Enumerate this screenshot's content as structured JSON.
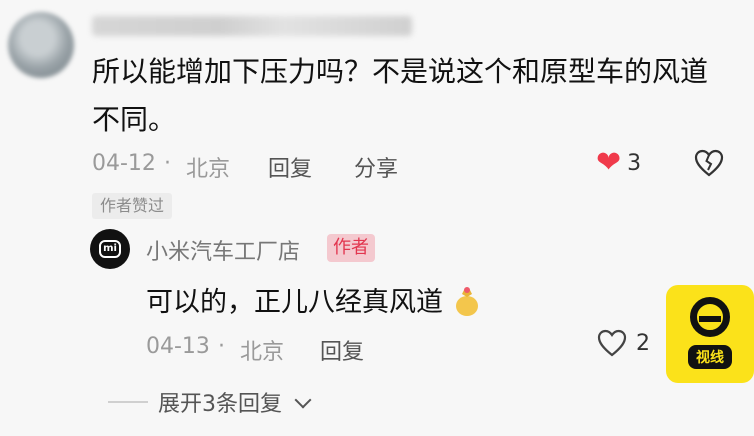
{
  "comment": {
    "text_line1": "所以能增加下压力吗？不是说这个和原型车的风道",
    "text_line2": "不同。",
    "date": "04-12",
    "separator": "·",
    "location": "北京",
    "reply_label": "回复",
    "share_label": "分享",
    "like_count": "3",
    "author_liked_label": "作者赞过"
  },
  "reply": {
    "author_name": "小米汽车工厂店",
    "author_badge": "作者",
    "text": "可以的，正儿八经真风道",
    "date": "04-13",
    "separator": "·",
    "location": "北京",
    "reply_label": "回复",
    "like_count": "2"
  },
  "expand": {
    "label": "展开3条回复"
  },
  "watermark": {
    "label": "视线"
  },
  "colors": {
    "like_active": "#f03a4b",
    "badge_bg": "#f4c9cf",
    "badge_text": "#e2364f",
    "watermark_bg": "#fbe21a"
  }
}
